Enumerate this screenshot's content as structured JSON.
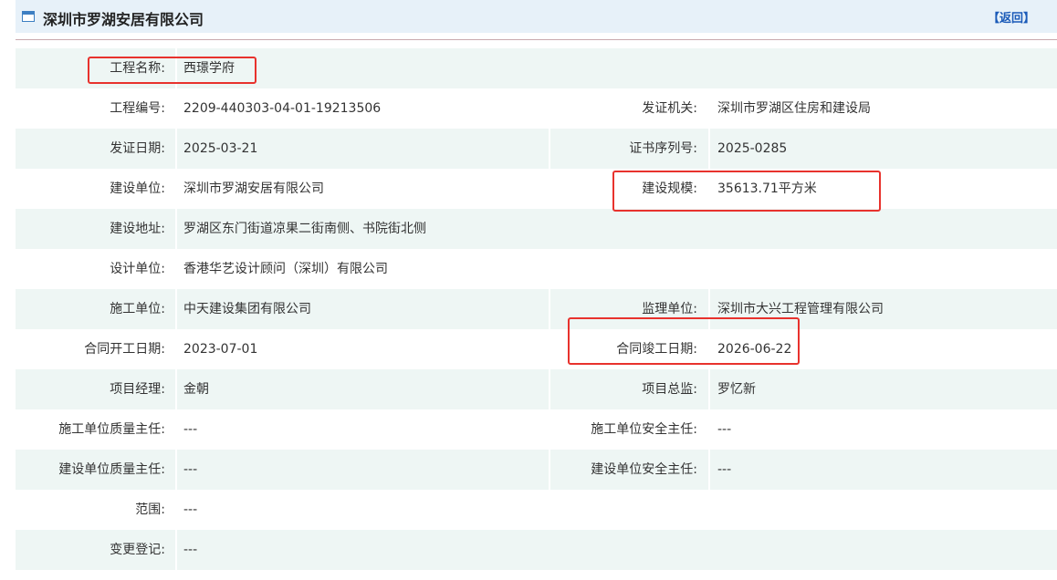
{
  "header": {
    "title": "深圳市罗湖安居有限公司",
    "back_label": "【返回】"
  },
  "rows": [
    {
      "label1": "工程名称:",
      "value1": "西璟学府",
      "label2": "",
      "value2": ""
    },
    {
      "label1": "工程编号:",
      "value1": "2209-440303-04-01-19213506",
      "label2": "发证机关:",
      "value2": "深圳市罗湖区住房和建设局"
    },
    {
      "label1": "发证日期:",
      "value1": "2025-03-21",
      "label2": "证书序列号:",
      "value2": "2025-0285"
    },
    {
      "label1": "建设单位:",
      "value1": "深圳市罗湖安居有限公司",
      "label2": "建设规模:",
      "value2": "35613.71平方米"
    },
    {
      "label1": "建设地址:",
      "value1": "罗湖区东门街道凉果二街南侧、书院街北侧",
      "label2": "",
      "value2": ""
    },
    {
      "label1": "设计单位:",
      "value1": "香港华艺设计顾问（深圳）有限公司",
      "label2": "",
      "value2": ""
    },
    {
      "label1": "施工单位:",
      "value1": "中天建设集团有限公司",
      "label2": "监理单位:",
      "value2": "深圳市大兴工程管理有限公司"
    },
    {
      "label1": "合同开工日期:",
      "value1": "2023-07-01",
      "label2": "合同竣工日期:",
      "value2": "2026-06-22"
    },
    {
      "label1": "项目经理:",
      "value1": "金朝",
      "label2": "项目总监:",
      "value2": "罗忆新"
    },
    {
      "label1": "施工单位质量主任:",
      "value1": "---",
      "label2": "施工单位安全主任:",
      "value2": "---"
    },
    {
      "label1": "建设单位质量主任:",
      "value1": "---",
      "label2": "建设单位安全主任:",
      "value2": "---"
    },
    {
      "label1": "范围:",
      "value1": "---",
      "label2": "",
      "value2": ""
    },
    {
      "label1": "变更登记:",
      "value1": "---",
      "label2": "",
      "value2": ""
    }
  ],
  "colors": {
    "header_bg": "#e7f1f9",
    "row_alt_bg": "#eef6f4",
    "highlight": "#e8322d",
    "link": "#1a5ab8"
  }
}
